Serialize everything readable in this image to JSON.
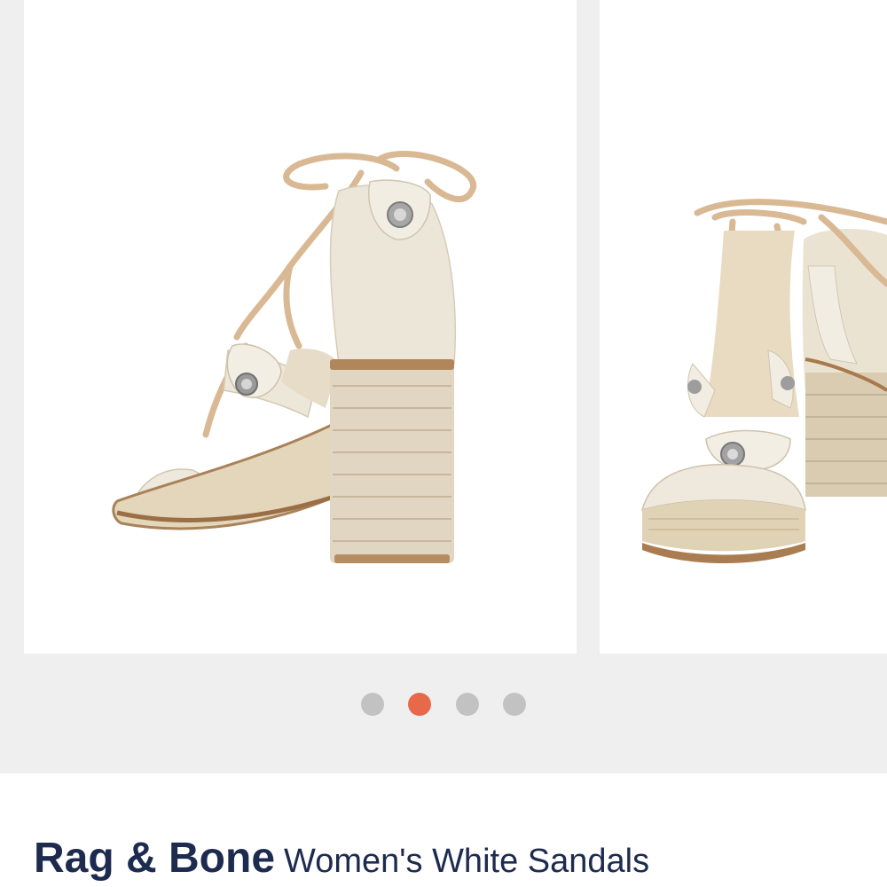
{
  "gallery": {
    "images": [
      {
        "alt": "sandal-back-view"
      },
      {
        "alt": "sandal-pair-front-view"
      }
    ],
    "dots": [
      {
        "active": false
      },
      {
        "active": true
      },
      {
        "active": false
      },
      {
        "active": false
      }
    ],
    "colors": {
      "dot_inactive": "#c2c2c2",
      "dot_active": "#e8684a",
      "background": "#efefef"
    }
  },
  "product": {
    "brand": "Rag & Bone",
    "title": "Women's White Sandals",
    "text_color": "#1d2b4f"
  }
}
